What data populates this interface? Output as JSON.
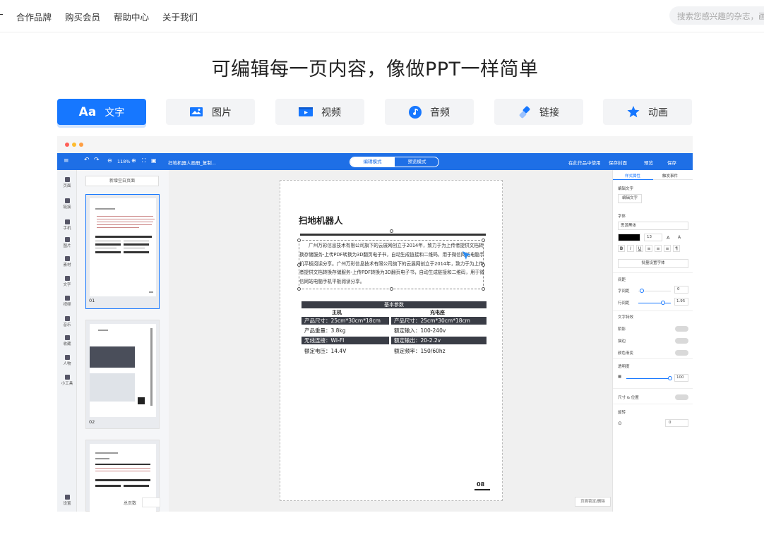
{
  "topnav": {
    "items": [
      "合作品牌",
      "购买会员",
      "帮助中心",
      "关于我们"
    ],
    "search_placeholder": "搜索您感兴趣的杂志，画"
  },
  "headline": "可编辑每一页内容，像做PPT一样简单",
  "tabs": [
    {
      "label": "文字",
      "icon": "text-aa-icon",
      "active": true
    },
    {
      "label": "图片",
      "icon": "image-icon",
      "active": false
    },
    {
      "label": "视频",
      "icon": "video-icon",
      "active": false
    },
    {
      "label": "音频",
      "icon": "music-icon",
      "active": false
    },
    {
      "label": "链接",
      "icon": "link-icon",
      "active": false
    },
    {
      "label": "动画",
      "icon": "star-icon",
      "active": false
    }
  ],
  "editor": {
    "toolbar": {
      "zoom": "118%",
      "doc_title": "扫地机器人画册_复制...",
      "mode_edit": "编辑模式",
      "mode_preview": "预览模式",
      "right_hint": "在此作品中使用",
      "save_cover": "保存封面",
      "preview": "预览",
      "save": "保存"
    },
    "rail": [
      "页面",
      "链接",
      "手机",
      "图片",
      "素材",
      "文字",
      "视频",
      "音乐",
      "收藏",
      "人物",
      "小工具",
      "设置"
    ],
    "thumbs": {
      "new_page": "新增空白页面",
      "pages": [
        "01",
        "02"
      ],
      "total_label": "总页数"
    },
    "page": {
      "title": "扫地机器人",
      "paragraph": "广州万彩信息技术有限公司旗下的云展网创立于2014年，致力于为上传者提供文档转换存储服务-上传PDF转换为3D翻页电子书，自动生成链接和二维码，用于微信网站电脑手机平板阅读分享。广州万彩信息技术有限公司旗下的云展网创立于2014年，致力于为上传者提供文档转换存储服务-上传PDF转换为3D翻页电子书，自动生成链接和二维码，用于微信网站电脑手机平板阅读分享。",
      "spec_title": "基本参数",
      "col_main": "主机",
      "col_dock": "充电座",
      "rows": [
        [
          "产品尺寸：25cm*30cm*18cm",
          "产品尺寸：25cm*30cm*18cm"
        ],
        [
          "产品重量：3.8kg",
          "额定输入：100-240v"
        ],
        [
          "无线连接：WI-FI",
          "额定输出：20-2.2v"
        ],
        [
          "额定电压：14.4V",
          "额定频率：150/60hz"
        ]
      ],
      "page_number": "08"
    },
    "panel": {
      "tab_style": "样式属性",
      "tab_event": "触发事件",
      "edit_text": "编辑文字",
      "edit_text_btn": "编辑文字",
      "font": "字体",
      "font_value": "思源黑体",
      "font_size": "13",
      "batch_btn": "批量设置字体",
      "spacing": "间距",
      "letter_spacing": "字间距",
      "letter_value": "0",
      "line_height": "行间距",
      "line_value": "1.95",
      "text_effect": "文字特效",
      "shadow": "阴影",
      "stroke": "描边",
      "gradient": "颜色渐变",
      "opacity": "透明度",
      "opacity_value": "100",
      "size_pos": "尺寸 & 位置",
      "rotate": "旋转",
      "rotate_value": "0"
    },
    "bottom_btn": "页面锁定/删除"
  }
}
